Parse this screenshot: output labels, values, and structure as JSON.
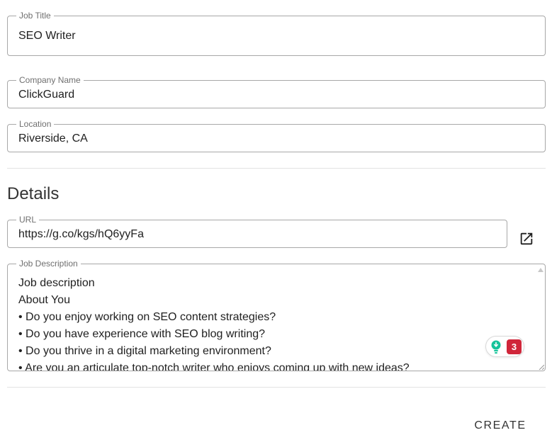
{
  "job_title": {
    "label": "Job Title",
    "value": "SEO Writer"
  },
  "company_name": {
    "label": "Company Name",
    "value": "ClickGuard"
  },
  "location": {
    "label": "Location",
    "value": "Riverside, CA"
  },
  "details": {
    "title": "Details",
    "url": {
      "label": "URL",
      "value": "https://g.co/kgs/hQ6yyFa"
    },
    "job_description": {
      "label": "Job Description",
      "lines": [
        "Job description",
        "About You",
        "• Do you enjoy working on SEO content strategies?",
        "• Do you have experience with SEO blog writing?",
        "• Do you thrive in a digital marketing environment?",
        "• Are you an articulate top-notch writer who enjoys coming up with new ideas?"
      ]
    }
  },
  "grammar_widget": {
    "count": "3",
    "accent": "#d0263a",
    "bulb_color": "#15c39a"
  },
  "actions": {
    "create_label": "CREATE"
  },
  "icons": {
    "open_external": "open-in-new-icon",
    "suggestion": "lightbulb-icon"
  }
}
